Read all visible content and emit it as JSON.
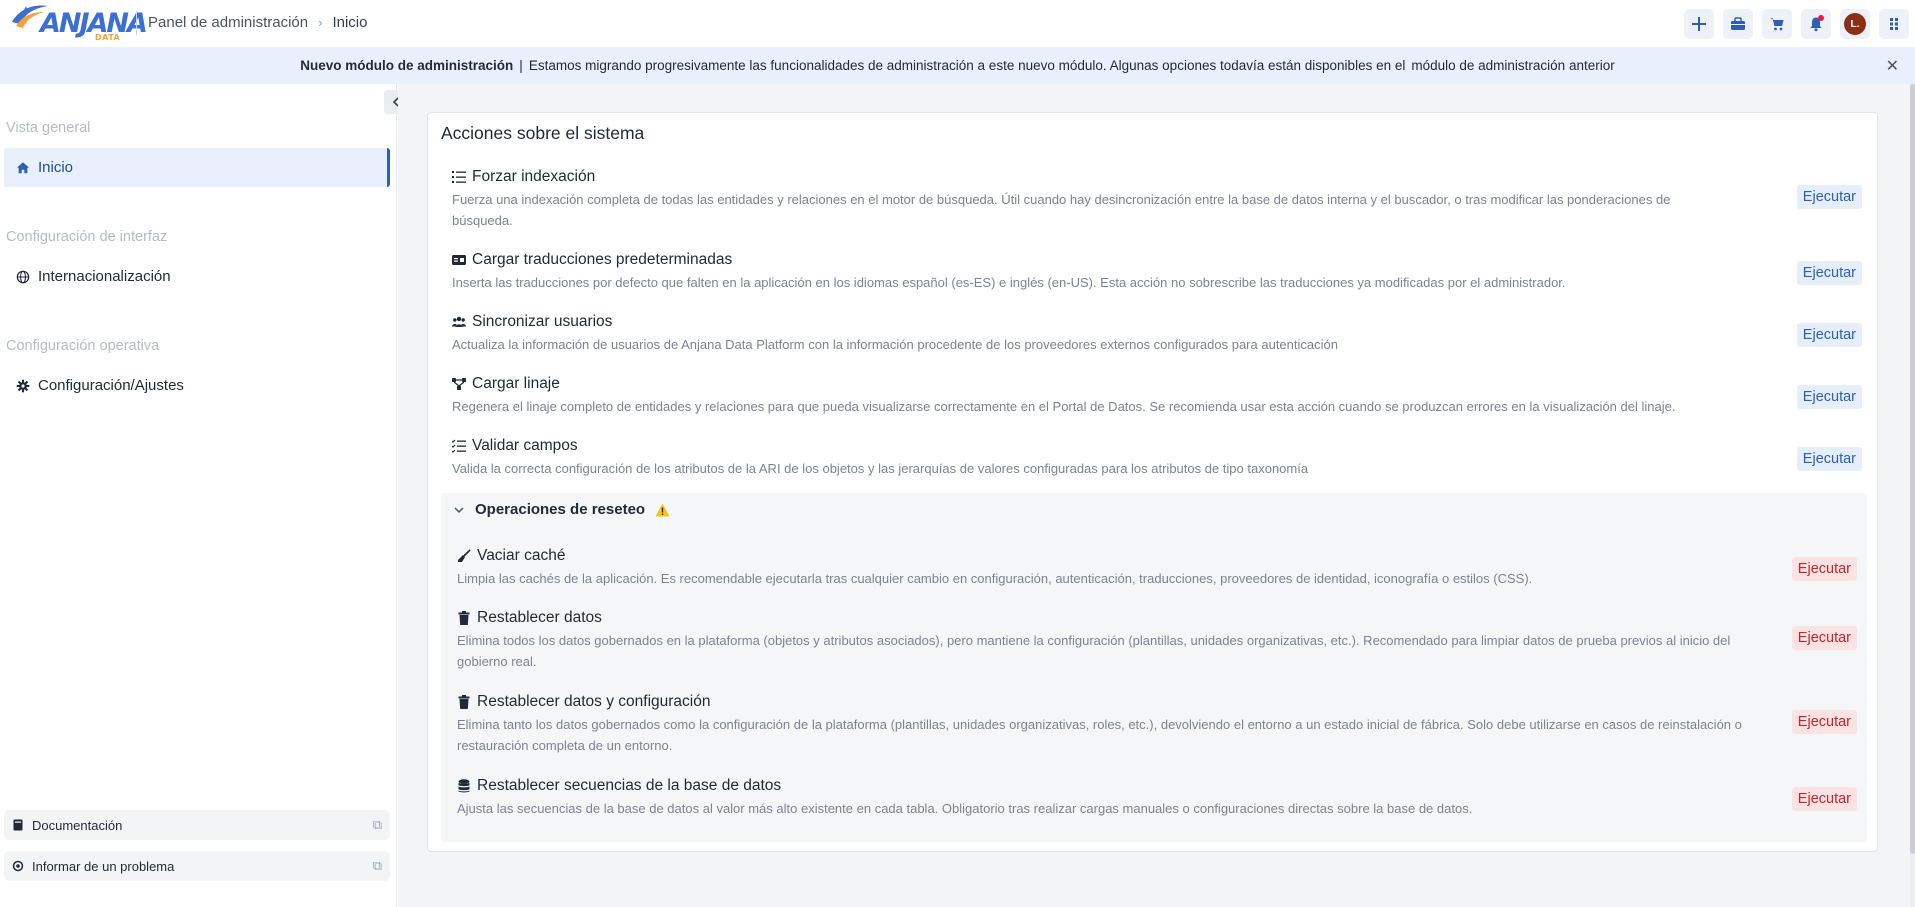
{
  "header": {
    "logo_text": "ANJANA",
    "logo_sub": "DATA",
    "breadcrumb": [
      "Panel de administración",
      "Inicio"
    ],
    "actions": [
      {
        "icon": "plus-icon"
      },
      {
        "icon": "briefcase-icon"
      },
      {
        "icon": "cart-icon"
      },
      {
        "icon": "bell-icon",
        "has_dot": true
      },
      {
        "icon": "avatar",
        "label": "L."
      },
      {
        "icon": "apps-grid-icon"
      }
    ]
  },
  "banner": {
    "title": "Nuevo módulo de administración",
    "separator": "|",
    "text": "Estamos migrando progresivamente las funcionalidades de administración a este nuevo módulo. Algunas opciones todavía están disponibles en el",
    "link": "módulo de administración anterior",
    "close": "✕"
  },
  "sidebar": {
    "sections": [
      {
        "title": "Vista general",
        "items": [
          {
            "label": "Inicio",
            "icon": "home-icon",
            "active": true
          }
        ]
      },
      {
        "title": "Configuración de interfaz",
        "items": [
          {
            "label": "Internacionalización",
            "icon": "globe-icon"
          }
        ]
      },
      {
        "title": "Configuración operativa",
        "items": [
          {
            "label": "Configuración/Ajustes",
            "icon": "gear-icon"
          }
        ]
      }
    ],
    "footer": [
      {
        "label": "Documentación",
        "icon": "book-icon"
      },
      {
        "label": "Informar de un problema",
        "icon": "support-icon"
      }
    ]
  },
  "main": {
    "card_title": "Acciones sobre el sistema",
    "run_label": "Ejecutar",
    "actions": [
      {
        "title": "Forzar indexación",
        "icon": "list-icon",
        "desc": "Fuerza una indexación completa de todas las entidades y relaciones en el motor de búsqueda. Útil cuando hay desincronización entre la base de datos interna y el buscador, o tras modificar las ponderaciones de búsqueda."
      },
      {
        "title": "Cargar traducciones predeterminadas",
        "icon": "language-icon",
        "desc": "Inserta las traducciones por defecto que falten en la aplicación en los idiomas español (es-ES) e inglés (en-US). Esta acción no sobrescribe las traducciones ya modificadas por el administrador."
      },
      {
        "title": "Sincronizar usuarios",
        "icon": "users-icon",
        "desc": "Actualiza la información de usuarios de Anjana Data Platform con la información procedente de los proveedores externos configurados para autenticación"
      },
      {
        "title": "Cargar linaje",
        "icon": "lineage-icon",
        "desc": "Regenera el linaje completo de entidades y relaciones para que pueda visualizarse correctamente en el Portal de Datos. Se recomienda usar esta acción cuando se produzcan errores en la visualización del linaje."
      },
      {
        "title": "Validar campos",
        "icon": "checklist-icon",
        "desc": "Valida la correcta configuración de los atributos de la ARI de los objetos y las jerarquías de valores configuradas para los atributos de tipo taxonomía"
      }
    ],
    "reset": {
      "title": "Operaciones de reseteo",
      "warning_icon": "warning-icon",
      "actions": [
        {
          "title": "Vaciar caché",
          "icon": "broom-icon",
          "desc": "Limpia las cachés de la aplicación. Es recomendable ejecutarla tras cualquier cambio en configuración, autenticación, traducciones, proveedores de identidad, iconografía o estilos (CSS)."
        },
        {
          "title": "Restablecer datos",
          "icon": "trash-icon",
          "desc": "Elimina todos los datos gobernados en la plataforma (objetos y atributos asociados), pero mantiene la configuración (plantillas, unidades organizativas, etc.). Recomendado para limpiar datos de prueba previos al inicio del gobierno real."
        },
        {
          "title": "Restablecer datos y configuración",
          "icon": "trash-icon",
          "desc": "Elimina tanto los datos gobernados como la configuración de la plataforma (plantillas, unidades organizativas, roles, etc.), devolviendo el entorno a un estado inicial de fábrica. Solo debe utilizarse en casos de reinstalación o restauración completa de un entorno."
        },
        {
          "title": "Restablecer secuencias de la base de datos",
          "icon": "database-icon",
          "desc": "Ajusta las secuencias de la base de datos al valor más alto existente en cada tabla. Obligatorio tras realizar cargas manuales o configuraciones directas sobre la base de datos."
        }
      ]
    }
  },
  "colors": {
    "accent": "#2b5fb8",
    "danger": "#c0262d",
    "banner_bg": "#e8f1fb"
  }
}
